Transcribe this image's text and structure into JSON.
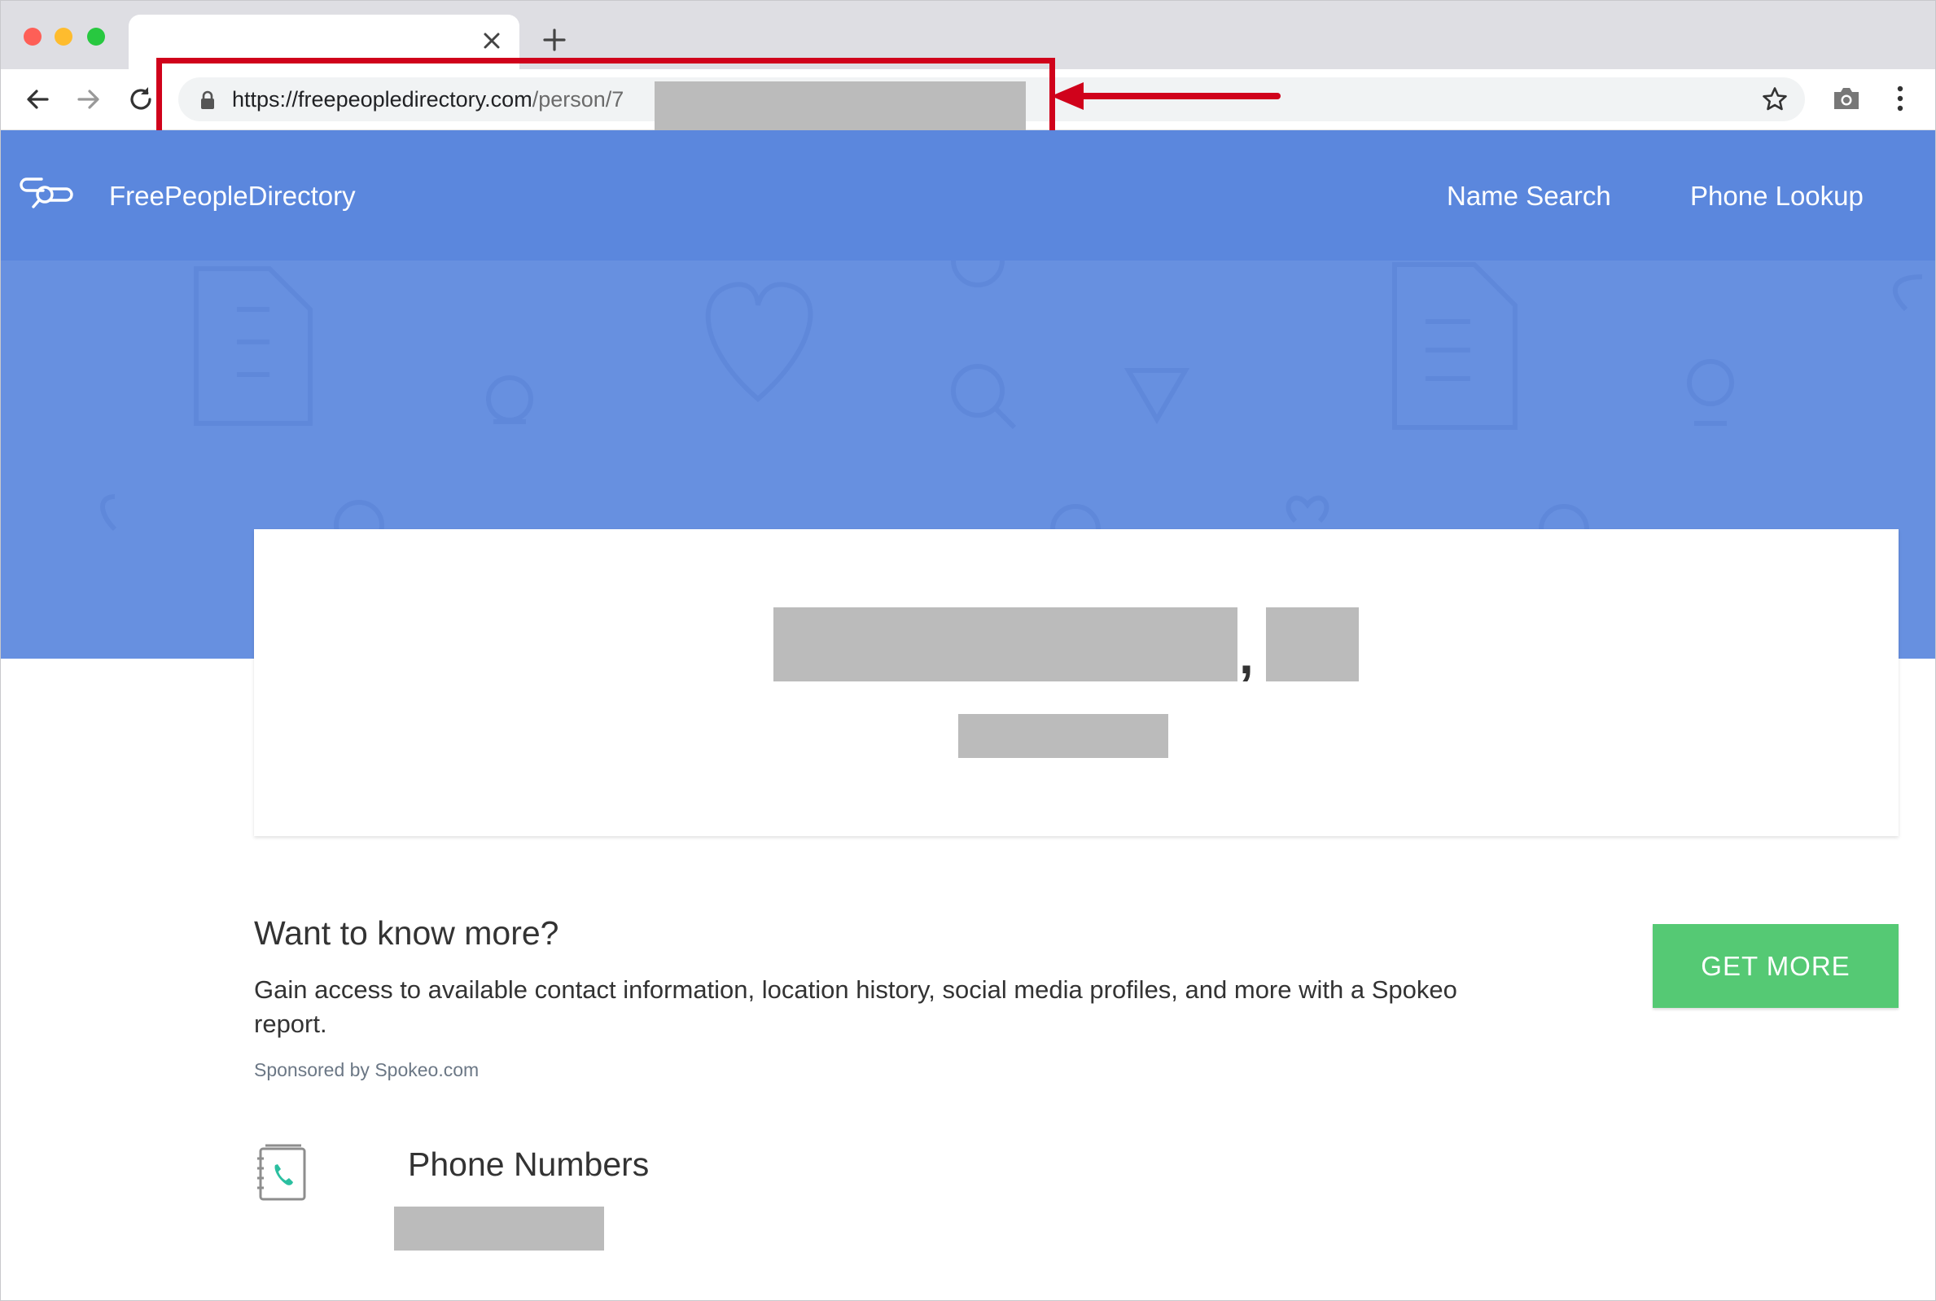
{
  "browser": {
    "url_domain": "https://freepeopledirectory.com",
    "url_path": "/person/",
    "url_path_partial": "7"
  },
  "header": {
    "brand": "FreePeopleDirectory",
    "nav": {
      "name_search": "Name Search",
      "phone_lookup": "Phone Lookup"
    }
  },
  "card": {
    "separator": ","
  },
  "promo": {
    "title": "Want to know more?",
    "text": "Gain access to available contact information, location history, social media profiles, and more with a Spokeo report.",
    "sponsored": "Sponsored by Spokeo.com",
    "button": "GET MORE"
  },
  "phone_section": {
    "title": "Phone Numbers"
  },
  "colors": {
    "header_blue": "#5b87dd",
    "hero_blue": "#6790e0",
    "button_green": "#55c974",
    "annotation_red": "#d0021b",
    "redaction_gray": "#bbbbbb",
    "phonebook_teal": "#2bbfa0"
  },
  "icons": [
    "back-arrow-icon",
    "forward-arrow-icon",
    "reload-icon",
    "lock-icon",
    "star-icon",
    "camera-icon",
    "more-vert-icon",
    "close-icon",
    "plus-icon",
    "logo-icon",
    "phonebook-icon"
  ]
}
